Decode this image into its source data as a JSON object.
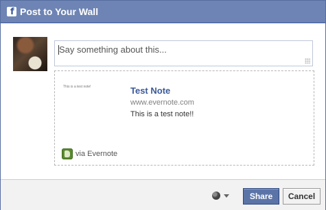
{
  "dialog": {
    "title": "Post to Your Wall",
    "logo_letter": "f"
  },
  "composer": {
    "placeholder": "Say something about this..."
  },
  "attachment": {
    "thumbnail_text": "This is a test note!",
    "title": "Test Note",
    "url": "www.evernote.com",
    "description": "This is a test note!!",
    "via": "via Evernote"
  },
  "footer": {
    "privacy_icon": "globe-icon",
    "share_label": "Share",
    "cancel_label": "Cancel"
  },
  "colors": {
    "titlebar": "#6d84b4",
    "link": "#3b5998",
    "share_button": "#5b74a8"
  }
}
